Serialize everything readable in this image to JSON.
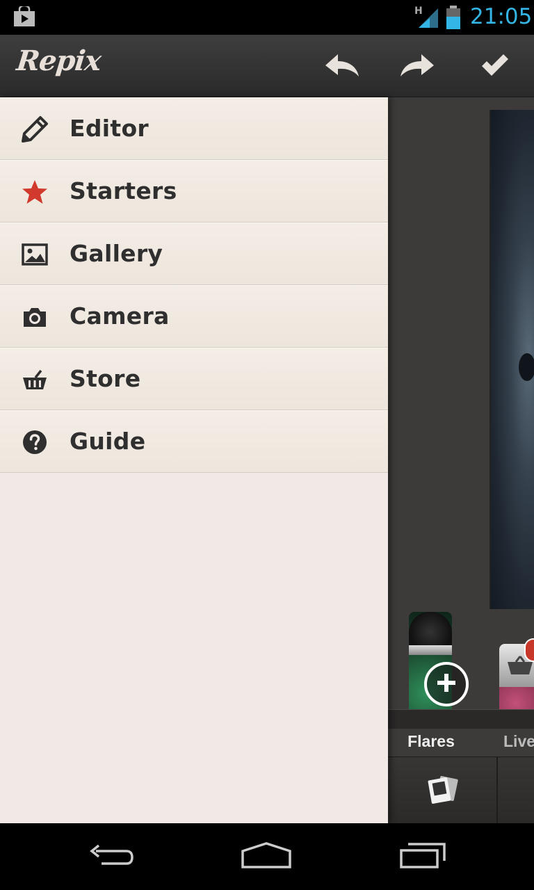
{
  "status_bar": {
    "network_type": "H",
    "time": "21:05"
  },
  "action_bar": {
    "app_name": "Repix"
  },
  "drawer": {
    "items": [
      {
        "label": "Editor",
        "icon": "pencil-icon"
      },
      {
        "label": "Starters",
        "icon": "star-icon"
      },
      {
        "label": "Gallery",
        "icon": "image-icon"
      },
      {
        "label": "Camera",
        "icon": "camera-icon"
      },
      {
        "label": "Store",
        "icon": "basket-icon"
      },
      {
        "label": "Guide",
        "icon": "help-icon"
      }
    ]
  },
  "editor": {
    "effects": [
      {
        "label": "Flares"
      },
      {
        "label": "Live"
      }
    ]
  },
  "colors": {
    "accent_clock": "#33b5e5",
    "star": "#d0392b",
    "drawer_bg": "#f1e9e5"
  }
}
